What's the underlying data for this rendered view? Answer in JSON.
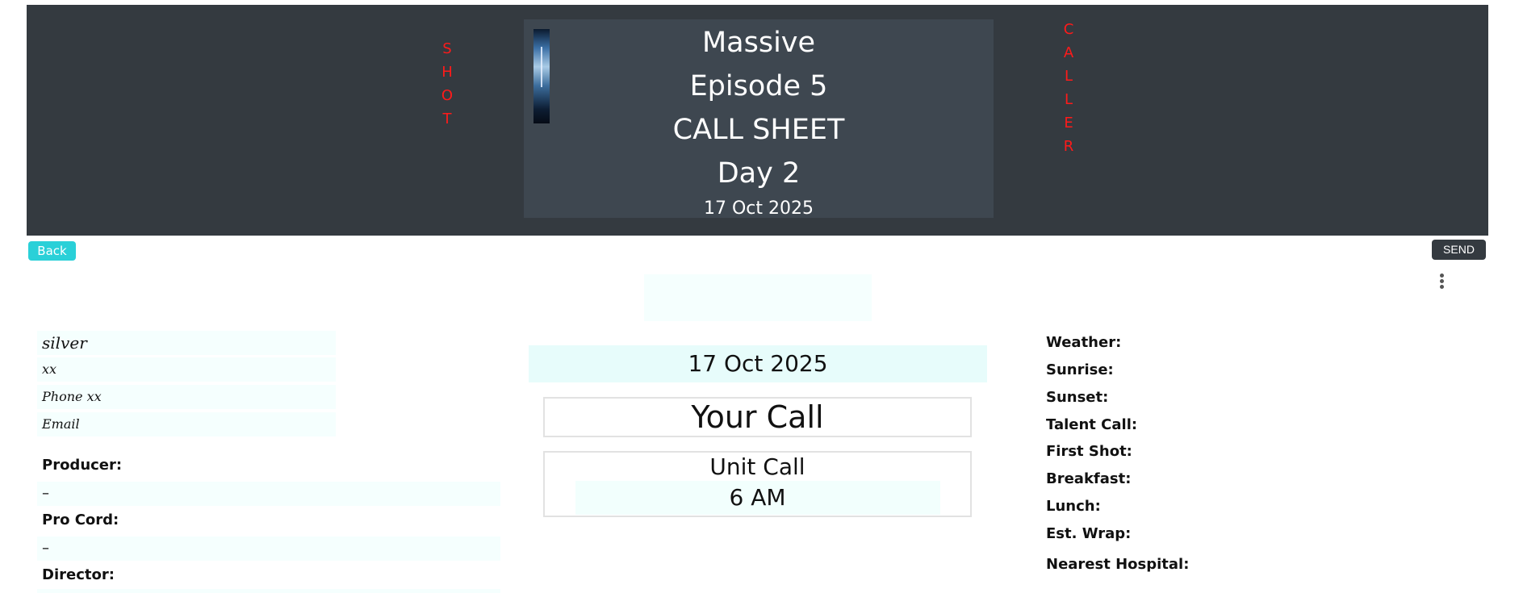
{
  "header": {
    "shot_letters": [
      "S",
      "H",
      "O",
      "T"
    ],
    "caller_letters": [
      "C",
      "A",
      "L",
      "L",
      "E",
      "R"
    ],
    "title_lines": [
      "Massive",
      "Episode 5",
      "CALL SHEET",
      "Day 2"
    ],
    "date": "17 Oct 2025"
  },
  "toolbar": {
    "back_label": "Back",
    "send_label": "SEND",
    "menu_icon": "vertical-ellipsis-icon"
  },
  "contact": {
    "name": "silver",
    "line2": "xx",
    "phone": "Phone xx",
    "email": "Email"
  },
  "crew": {
    "producer_label": "Producer:",
    "producer_value": "–",
    "pro_cord_label": "Pro Cord:",
    "pro_cord_value": "–",
    "director_label": "Director:"
  },
  "center": {
    "date": "17 Oct 2025",
    "your_call": "Your Call",
    "unit_call_label": "Unit Call",
    "unit_call_value": "6 AM"
  },
  "info": {
    "weather": "Weather:",
    "sunrise": "Sunrise:",
    "sunset": "Sunset:",
    "talent_call": "Talent Call:",
    "first_shot": "First Shot:",
    "breakfast": "Breakfast:",
    "lunch": "Lunch:",
    "est_wrap": "Est. Wrap:",
    "nearest_hospital": "Nearest Hospital:"
  },
  "colors": {
    "header_bg": "#343a40",
    "title_box_bg": "#3e4750",
    "vertical_text": "#ff1a1a",
    "back_button": "#2ad0d8",
    "field_bg": "#f5fffe"
  }
}
